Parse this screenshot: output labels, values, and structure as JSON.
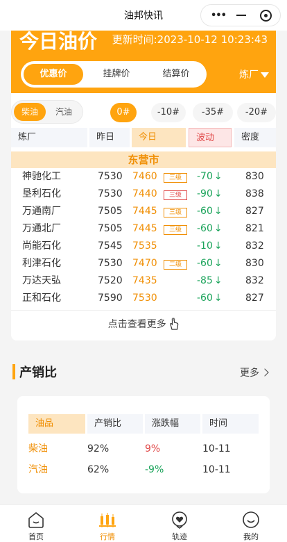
{
  "app": {
    "title": "油邦快讯"
  },
  "header": {
    "title": "今日油价",
    "update_time": "更新时间:2023-10-12 10:23:43",
    "price_tabs": [
      "优惠价",
      "挂牌价",
      "结算价"
    ],
    "factory_filter": "炼厂"
  },
  "fuel_types": [
    "柴油",
    "汽油"
  ],
  "grades": [
    "0#",
    "-10#",
    "-35#",
    "-20#"
  ],
  "table": {
    "headers": [
      "炼厂",
      "昨日",
      "今日",
      "波动",
      "密度"
    ],
    "region": "东营市",
    "rows": [
      {
        "name": "神驰化工",
        "yesterday": "7530",
        "today": "7460",
        "badge": "三级",
        "change": "-70",
        "density": "830"
      },
      {
        "name": "垦利石化",
        "yesterday": "7530",
        "today": "7440",
        "badge": "三级",
        "change": "-90",
        "density": "838"
      },
      {
        "name": "万通南厂",
        "yesterday": "7505",
        "today": "7445",
        "badge": "三级",
        "change": "-60",
        "density": "827"
      },
      {
        "name": "万通北厂",
        "yesterday": "7505",
        "today": "7445",
        "badge": "三级",
        "change": "-60",
        "density": "821"
      },
      {
        "name": "尚能石化",
        "yesterday": "7545",
        "today": "7535",
        "badge": "",
        "change": "-10",
        "density": "832"
      },
      {
        "name": "利津石化",
        "yesterday": "7530",
        "today": "7470",
        "badge": "二级",
        "change": "-60",
        "density": "830"
      },
      {
        "name": "万达天弘",
        "yesterday": "7520",
        "today": "7435",
        "badge": "",
        "change": "-85",
        "density": "832"
      },
      {
        "name": "正和石化",
        "yesterday": "7590",
        "today": "7530",
        "badge": "",
        "change": "-60",
        "density": "827"
      }
    ],
    "more_label": "点击查看更多"
  },
  "ratio_section": {
    "title": "产销比",
    "more_label": "更多",
    "headers": [
      "油品",
      "产销比",
      "涨跌幅",
      "时间"
    ],
    "rows": [
      {
        "product": "柴油",
        "ratio": "92%",
        "change": "9%",
        "date": "10-11"
      },
      {
        "product": "汽油",
        "ratio": "62%",
        "change": "-9%",
        "date": "10-11"
      }
    ]
  },
  "tabbar": [
    {
      "label": "首页",
      "icon": "home-icon"
    },
    {
      "label": "行情",
      "icon": "candlestick-icon"
    },
    {
      "label": "轨迹",
      "icon": "track-icon"
    },
    {
      "label": "我的",
      "icon": "profile-icon"
    }
  ],
  "colors": {
    "accent": "#ffa40f",
    "down": "#1aa35a",
    "up": "#e04848"
  }
}
